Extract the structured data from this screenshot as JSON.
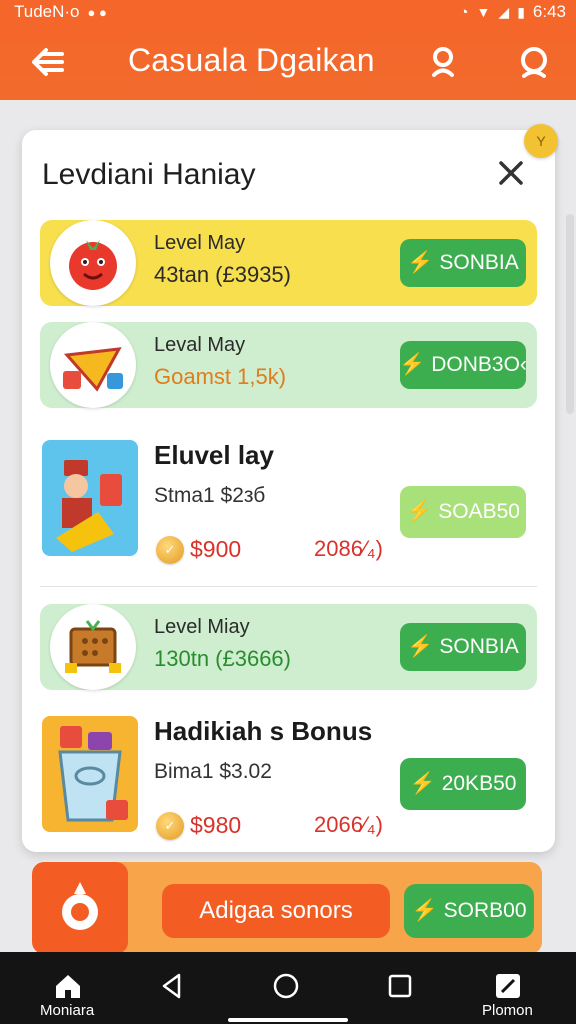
{
  "status_bar": {
    "carrier": "TudeN·o",
    "time": "6:43"
  },
  "app_bar": {
    "title": "Casuala Dgaikan"
  },
  "modal": {
    "title": "Levdiani Haniay",
    "corner_badge": "Y",
    "rows": [
      {
        "type": "pill",
        "line1": "Level May",
        "line2": "43tan (£3935)",
        "button": "SONBIA",
        "bg": "#f8df4e",
        "line2_color": "#2b2b2b"
      },
      {
        "type": "pill",
        "line1": "Leval May",
        "line2": "Goamst 1,5k)",
        "button": "DONB3O‹",
        "bg": "#cfeecf",
        "line2_color": "#e07c1c"
      },
      {
        "type": "plain",
        "name": "Eluvel lay",
        "sub": "Stma1 $2зб",
        "price": "$900",
        "pct": "2086⁄₄)",
        "button": "SOAB50",
        "button_color": "#a8e07a"
      },
      {
        "type": "pill",
        "line1": "Level Miay",
        "line2": "130tn (£3666)",
        "button": "SONBIA",
        "bg": "#cfeecf",
        "line2_color": "#2a8c2f"
      },
      {
        "type": "plain",
        "name": "Hadikiah s Bonus",
        "sub": "Bima1 $3.02",
        "price": "$980",
        "pct": "2066⁄₄)",
        "button": "20KB50",
        "button_color": "#3dae4f"
      }
    ]
  },
  "banner": {
    "cta": "Adigaa sonors",
    "button": "SORB00"
  },
  "navbar": {
    "left_label": "Moniara",
    "right_label": "Plomon"
  },
  "colors": {
    "accent": "#f4662a",
    "green": "#3dae4f",
    "yellow": "#f8df4e"
  }
}
